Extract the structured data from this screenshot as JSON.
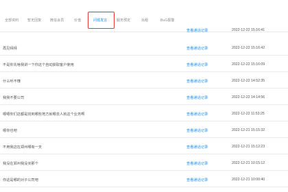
{
  "tabs": [
    {
      "label": "全部资料"
    },
    {
      "label": "暂无回复"
    },
    {
      "label": "微信会员"
    },
    {
      "label": "价值"
    },
    {
      "label": "问题发言"
    },
    {
      "label": "服务预定"
    },
    {
      "label": "出租"
    },
    {
      "label": "BuG报警"
    }
  ],
  "active_tab_index": 4,
  "rows": [
    {
      "question": "",
      "link": "查看通话记录",
      "time": "2022-12-22 15:16:41"
    },
    {
      "question": "再见拜拜",
      "link": "查看通话记录",
      "time": "2022-12-22 15:16:42"
    },
    {
      "question": "不是你先啥我讲一下你这个自动获取客户使用",
      "link": "查看通话记录",
      "time": "2022-12-22 15:16:09"
    },
    {
      "question": "什么听不懂",
      "link": "查看通话记录",
      "time": "2022-12-22 14:52:35"
    },
    {
      "question": "我我不要公司",
      "link": "查看通话记录",
      "time": "2022-12-22 14:14:56"
    },
    {
      "question": "嗯嗯你们这都是找到哪些地方就哪去人就这个业务啊",
      "link": "查看通话记录",
      "time": "2022-12-22 11:53:25"
    },
    {
      "question": "嗯你也吧",
      "link": "查看通话记录",
      "time": "2022-12-21 15:15:32"
    },
    {
      "question": "不用我这在郑州哪有一天",
      "link": "查看通话记录",
      "time": "2022-12-21 15:12:23"
    },
    {
      "question": "我没在郑州我没买那个",
      "link": "查看通话记录",
      "time": "2022-12-21 10:15:12"
    },
    {
      "question": "你这是哪的对子公司吧",
      "link": "查看通话记录",
      "time": "2022-12-21 10:00:40"
    }
  ]
}
